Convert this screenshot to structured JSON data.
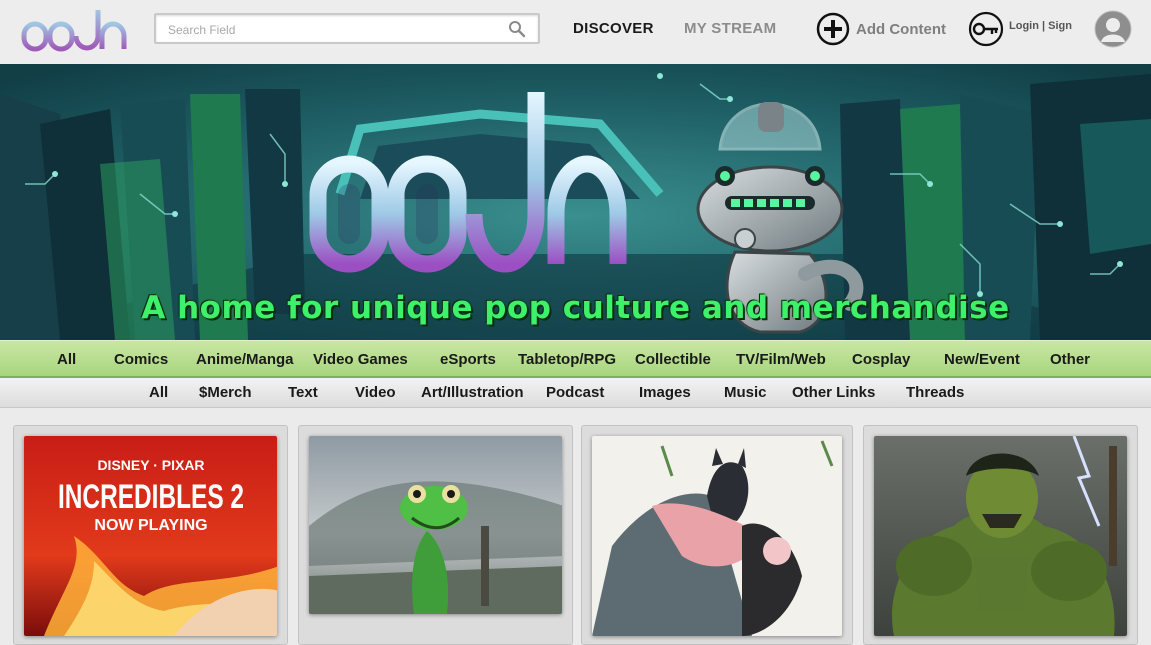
{
  "header": {
    "logo_text": "oodon",
    "search_placeholder": "Search Field",
    "nav_discover": "DISCOVER",
    "nav_stream": "MY STREAM",
    "add_content": "Add Content",
    "login": "Login | Sign"
  },
  "banner": {
    "logo_text": "oodon",
    "tagline": "A home for unique pop culture and merchandise"
  },
  "categories": [
    "All",
    "Comics",
    "Anime/Manga",
    "Video Games",
    "eSports",
    "Tabletop/RPG",
    "Collectible",
    "TV/Film/Web",
    "Cosplay",
    "New/Event",
    "Other"
  ],
  "types": [
    "All",
    "$Merch",
    "Text",
    "Video",
    "Art/Illustration",
    "Podcast",
    "Images",
    "Music",
    "Other Links",
    "Threads"
  ],
  "cards": {
    "c1": {
      "brand": "DISNEY · PIXAR",
      "title": "INCREDIBLES 2",
      "subtitle": "NOW PLAYING"
    }
  },
  "colors": {
    "accent_green": "#a7d57e",
    "tagline_green": "#3ef06a",
    "banner_teal": "#1d5d63"
  }
}
